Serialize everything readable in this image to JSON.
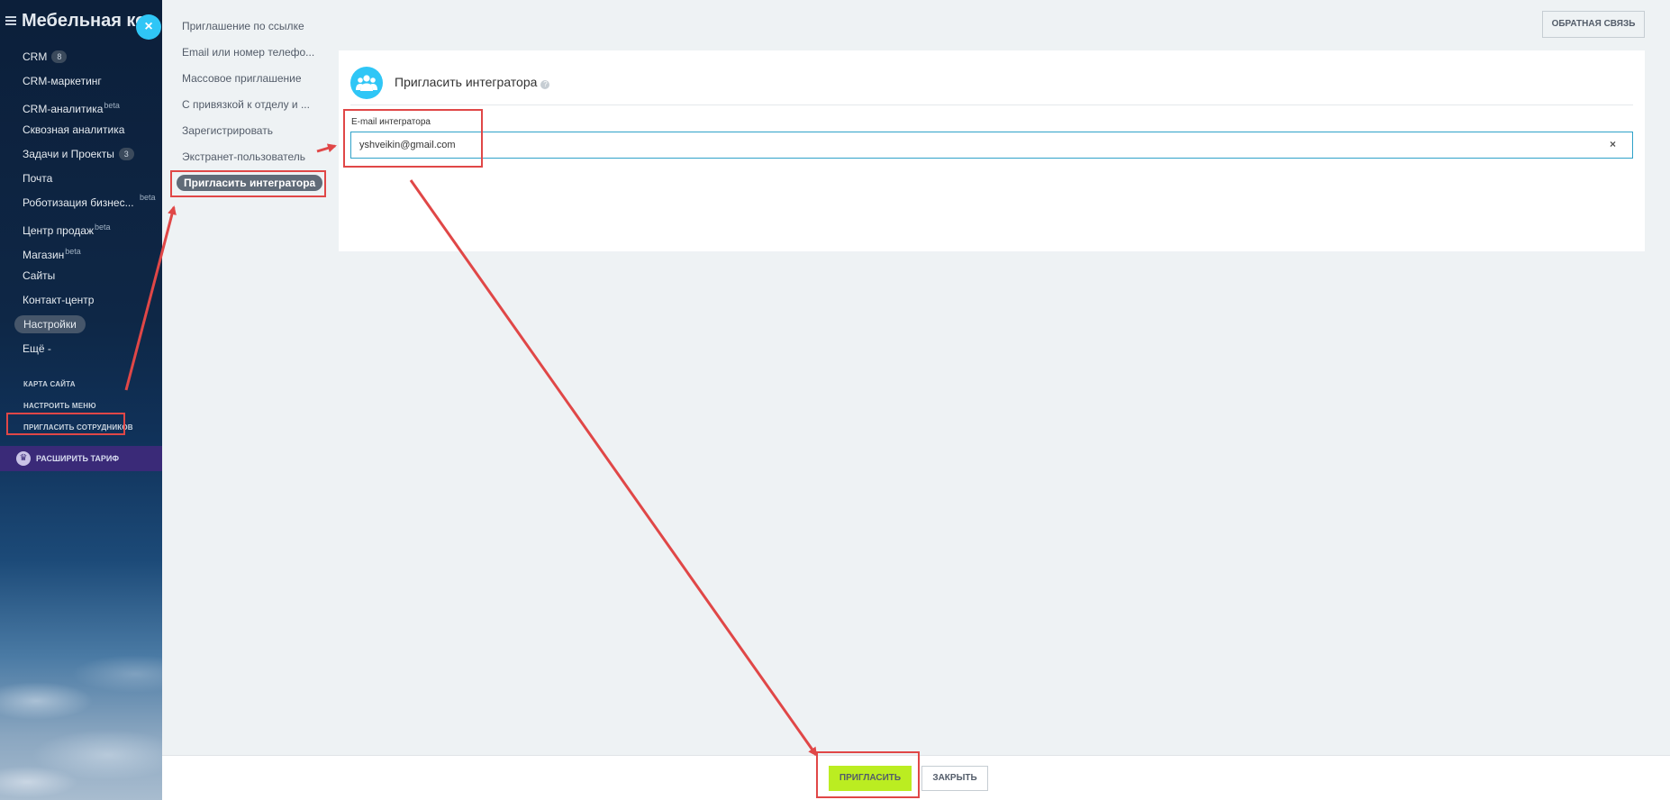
{
  "sidebar": {
    "company": "Мебельная компания",
    "items": [
      {
        "label": "CRM",
        "badge": "8"
      },
      {
        "label": "CRM-маркетинг"
      },
      {
        "label": "CRM-аналитика",
        "sup": "beta"
      },
      {
        "label": "Сквозная аналитика"
      },
      {
        "label": "Задачи и Проекты",
        "badge": "3"
      },
      {
        "label": "Почта"
      },
      {
        "label": "Роботизация бизнес...",
        "sup": "beta"
      },
      {
        "label": "Центр продаж",
        "sup": "beta"
      },
      {
        "label": "Магазин",
        "sup": "beta"
      },
      {
        "label": "Сайты"
      },
      {
        "label": "Контакт-центр"
      },
      {
        "label": "Настройки",
        "active": true
      },
      {
        "label": "Ещё -"
      }
    ],
    "site_map": "КАРТА САЙТА",
    "configure_menu": "НАСТРОИТЬ МЕНЮ",
    "invite_employees": "ПРИГЛАСИТЬ СОТРУДНИКОВ",
    "upgrade": "РАСШИРИТЬ ТАРИФ"
  },
  "close_icon": "×",
  "sub_nav": {
    "items": [
      "Приглашение по ссылке",
      "Email или номер телефо...",
      "Массовое приглашение",
      "С привязкой к отделу и ...",
      "Зарегистрировать",
      "Экстранет-пользователь"
    ],
    "active": "Пригласить интегратора"
  },
  "feedback_label": "ОБРАТНАЯ СВЯЗЬ",
  "card": {
    "title": "Пригласить интегратора",
    "help": "?",
    "field_label": "E-mail интегратора",
    "field_value": "yshveikin@gmail.com",
    "clear_icon": "×"
  },
  "footer": {
    "invite_label": "ПРИГЛАСИТЬ",
    "close_label": "ЗАКРЫТЬ"
  },
  "colors": {
    "accent": "#2fc6f6",
    "invite_button": "#bbed21",
    "annotation": "#e04747"
  }
}
